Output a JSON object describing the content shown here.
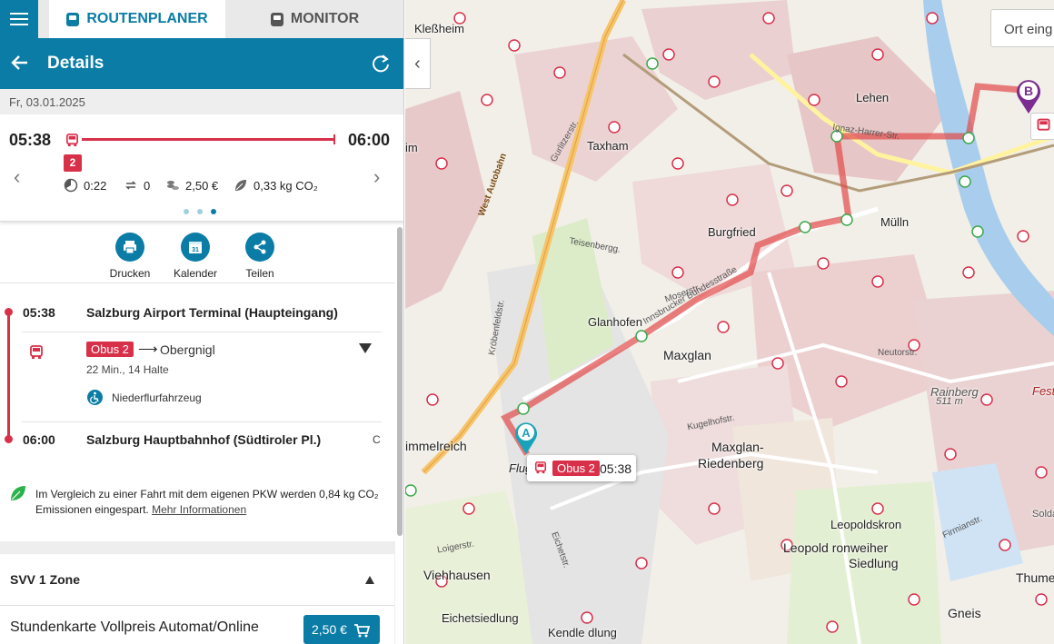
{
  "tabs": {
    "routenplaner": "ROUTENPLANER",
    "monitor": "MONITOR"
  },
  "header": {
    "title": "Details"
  },
  "date": "Fr, 03.01.2025",
  "summary": {
    "departure": "05:38",
    "arrival": "06:00",
    "line": "2",
    "duration": "0:22",
    "changes": "0",
    "price": "2,50 €",
    "co2": "0,33 kg CO₂"
  },
  "actions": {
    "print": "Drucken",
    "calendar": "Kalender",
    "calendar_day": "31",
    "share": "Teilen"
  },
  "itinerary": {
    "departure_time": "05:38",
    "departure_stop": "Salzburg Airport Terminal (Haupteingang)",
    "line": "Obus 2",
    "arrow": "⟶",
    "destination": "Obergnigl",
    "info": "22 Min., 14 Halte",
    "feature": "Niederflurfahrzeug",
    "arrival_time": "06:00",
    "arrival_stop": "Salzburg Hauptbahnhof (Südtiroler Pl.)",
    "arrival_platform": "C"
  },
  "co2_note": {
    "text": "Im Vergleich zu einer Fahrt mit dem eigenen PKW werden 0,84 kg CO₂ Emissionen eingespart.",
    "link": "Mehr Informationen"
  },
  "fare": {
    "zone": "SVV 1 Zone",
    "ticket": "Stundenkarte Vollpreis Automat/Online",
    "price": "2,50 €"
  },
  "map": {
    "search_placeholder": "Ort eing",
    "pin_a": "A",
    "pin_b": "B",
    "tooltip_line": "Obus 2",
    "tooltip_time": "05:38",
    "places": {
      "klessheim": "Kleßheim",
      "taxham": "Taxham",
      "burgfried": "Burgfried",
      "muelln": "Mülln",
      "lehen": "Lehen",
      "glanhofen": "Glanhofen",
      "maxglan": "Maxglan",
      "himmelreich": "immelreich",
      "flug": "Flug",
      "maxglan_riedenberg_1": "Maxglan-",
      "maxglan_riedenberg_2": "Riedenberg",
      "leopoldskron": "Leopoldskron",
      "leopoldskron_moos_1": "Leopold  ronweiher",
      "leopoldskron_moos_2": "Siedlung",
      "viehhausen": "Viehhausen",
      "eichetsiedlung": "Eichetsiedlung",
      "kendler": "Kendle  dlung",
      "rainberg": "Rainberg",
      "rainberg_alt": "511 m",
      "gneis": "Gneis",
      "thume": "Thume",
      "fest": "Fest",
      "im": "im",
      "solda": "Solda"
    },
    "streets": {
      "west_autobahn": "West Autobahn",
      "ignaz": "Ignaz-Harrer-Str.",
      "innsbrucker": "Innsbrucker Bundesstraße",
      "teisenberg": "Teisenbergg.",
      "moser": "Moserstr.",
      "kroeben": "Kröbenfeldstr.",
      "gurlitzer": "Gurlitzerstr.",
      "neutor": "Neutorstr.",
      "kugel": "Kugelhofstr.",
      "fuerberg": "Firmianstr.",
      "loig": "Loigerstr.",
      "eichet": "Eichetstr."
    }
  }
}
